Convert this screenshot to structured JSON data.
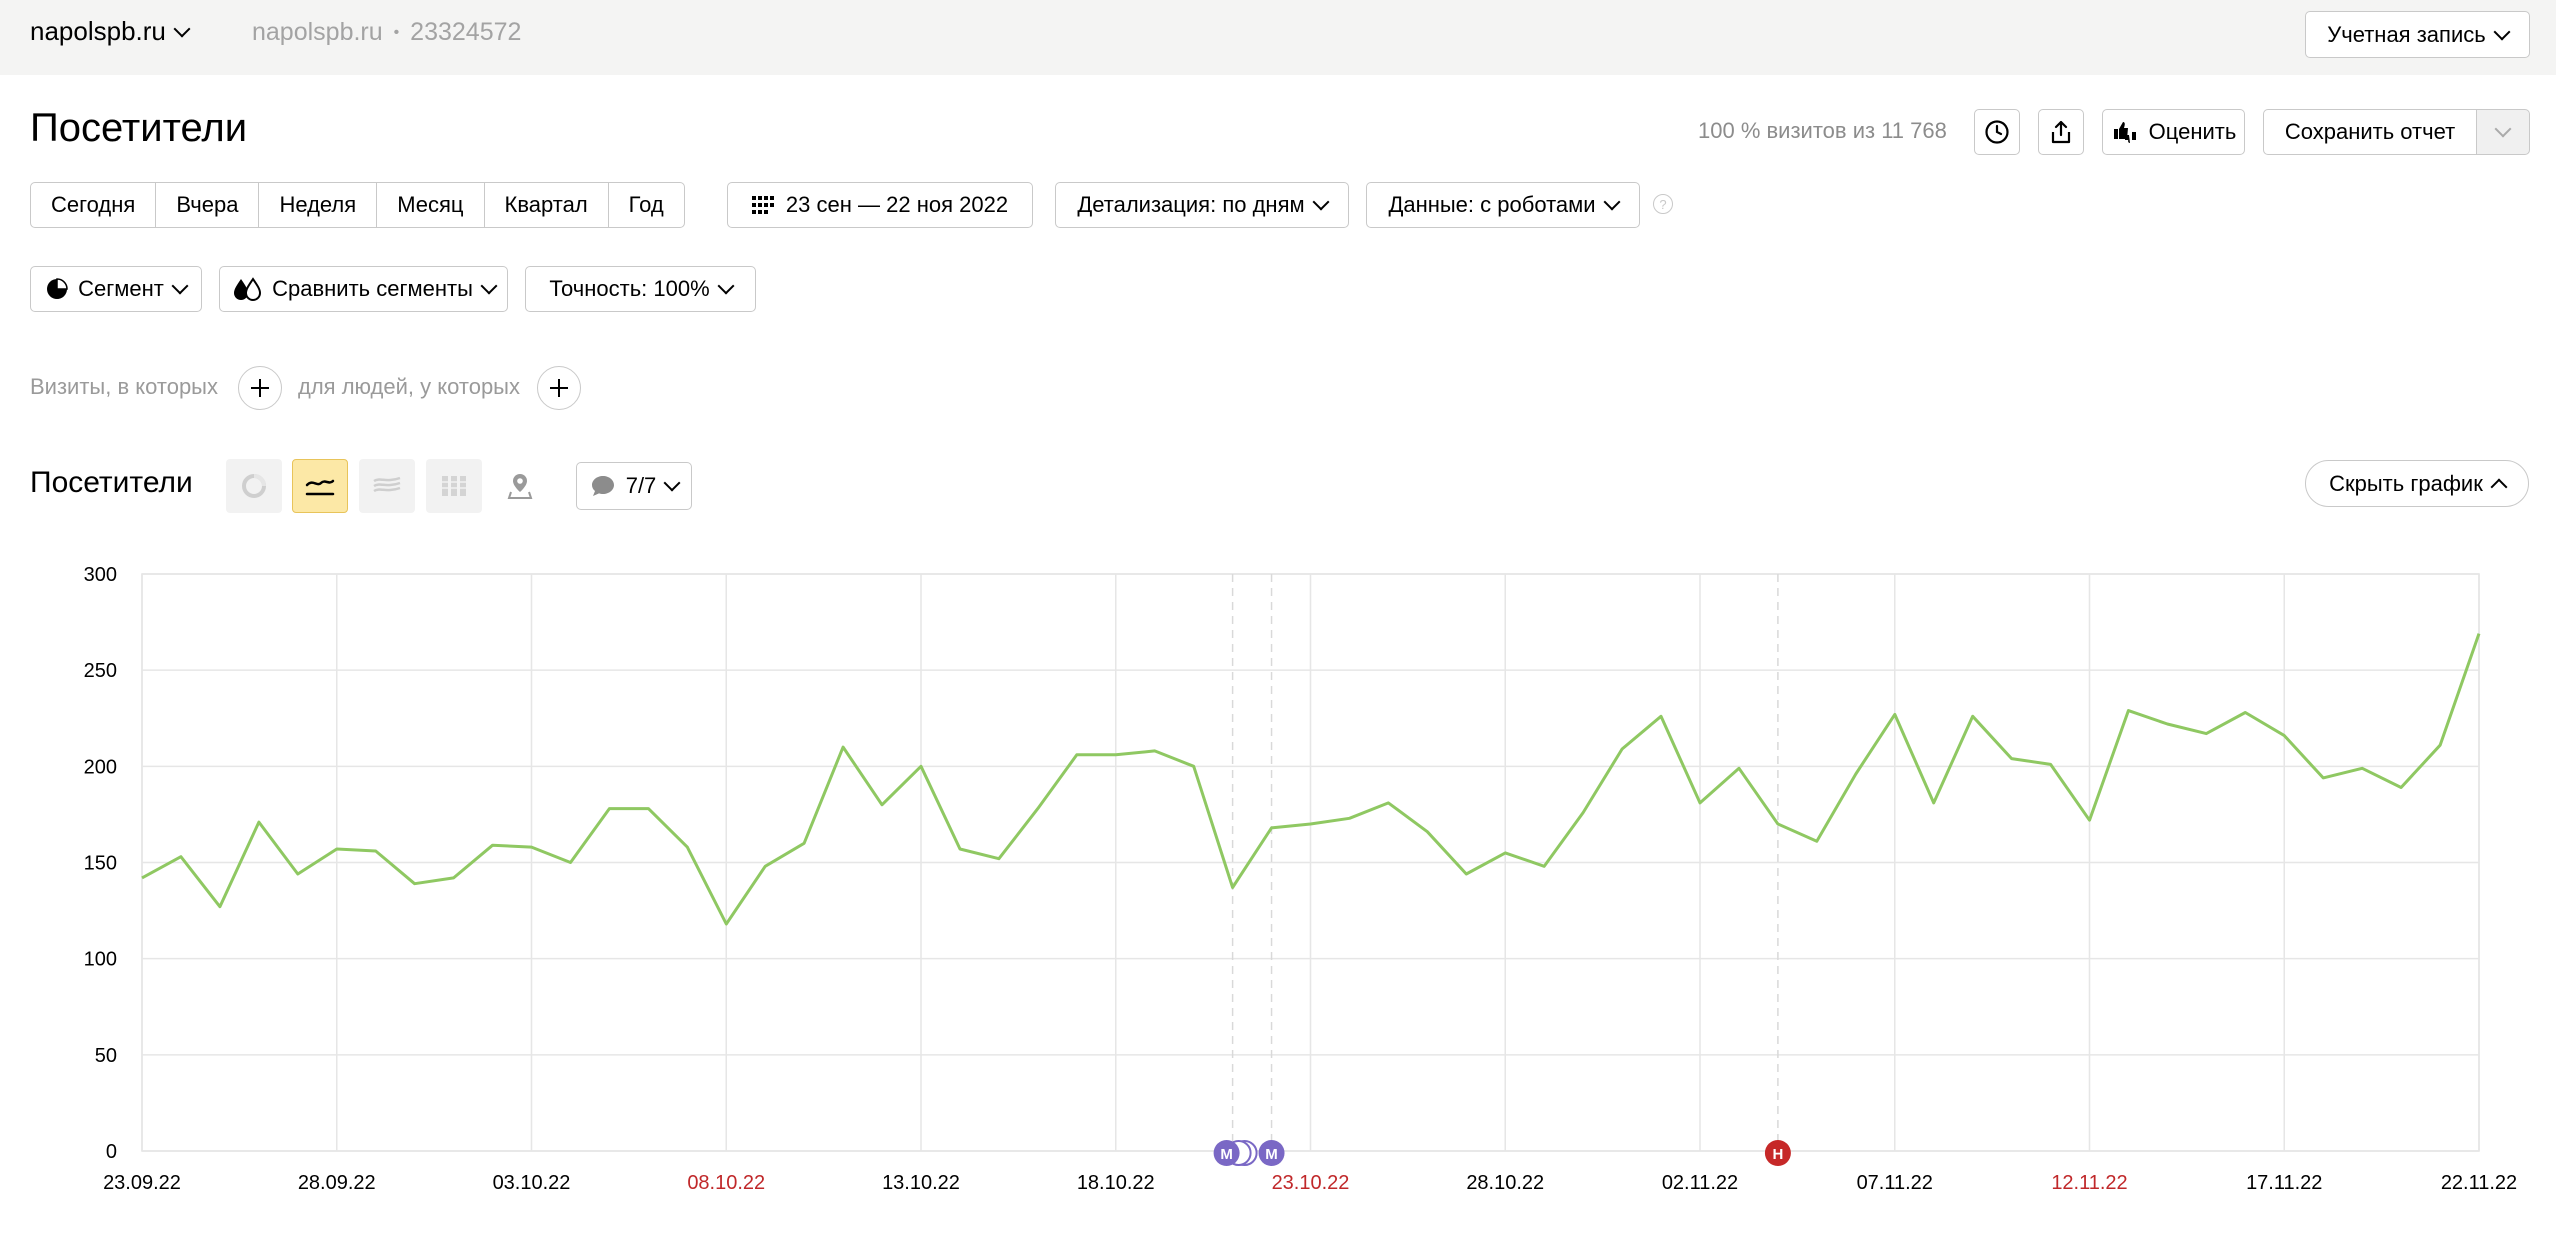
{
  "header": {
    "site_name": "napolspb.ru",
    "site_meta_name": "napolspb.ru",
    "site_meta_sep": "•",
    "counter_id": "23324572",
    "account_label": "Учетная запись"
  },
  "page": {
    "title": "Посетители",
    "visits_share": "100 % визитов из 11 768",
    "rate_label": "Оценить",
    "save_label": "Сохранить отчет"
  },
  "periods": [
    "Сегодня",
    "Вчера",
    "Неделя",
    "Месяц",
    "Квартал",
    "Год"
  ],
  "date_range": "23 сен — 22 ноя 2022",
  "detail_label": "Детализация: по дням",
  "data_label": "Данные: с роботами",
  "segment_label": "Сегмент",
  "compare_label": "Сравнить сегменты",
  "accuracy_label": "Точность: 100%",
  "filters": {
    "visits_label": "Визиты, в которых",
    "people_label": "для людей, у которых"
  },
  "chart_section": {
    "title": "Посетители",
    "notes_label": "7/7",
    "hide_label": "Скрыть график"
  },
  "colors": {
    "line": "#8fc862",
    "weekend_label": "#c0282a",
    "note_purple": "#7a68c5",
    "note_red": "#c62828"
  },
  "chart_data": {
    "type": "line",
    "ylim": [
      0,
      300
    ],
    "y_ticks": [
      "0",
      "50",
      "100",
      "150",
      "200",
      "250",
      "300"
    ],
    "x_tick_labels": [
      "23.09.22",
      "28.09.22",
      "03.10.22",
      "08.10.22",
      "13.10.22",
      "18.10.22",
      "23.10.22",
      "28.10.22",
      "02.11.22",
      "07.11.22",
      "12.11.22",
      "17.11.22",
      "22.11.22"
    ],
    "weekend_ticks": [
      "08.10.22",
      "23.10.22",
      "12.11.22"
    ],
    "series": [
      {
        "values": [
          142,
          153,
          127,
          171,
          144,
          157,
          156,
          139,
          142,
          159,
          158,
          150,
          178,
          178,
          158,
          118,
          148,
          160,
          210,
          180,
          200,
          157,
          152,
          178,
          206,
          206,
          208,
          200,
          137,
          168,
          170,
          173,
          181,
          166,
          144,
          155,
          148,
          176,
          209,
          226,
          181,
          199,
          170,
          161,
          196,
          227,
          181,
          226,
          204,
          201,
          172,
          229,
          222,
          217,
          228,
          216,
          194,
          199,
          189,
          211,
          269
        ]
      }
    ],
    "notes": [
      {
        "day_index": 28,
        "label": "M",
        "kind": "stack"
      },
      {
        "day_index": 29,
        "label": "M",
        "kind": "single"
      },
      {
        "day_index": 42,
        "label": "Н",
        "kind": "red"
      }
    ]
  }
}
